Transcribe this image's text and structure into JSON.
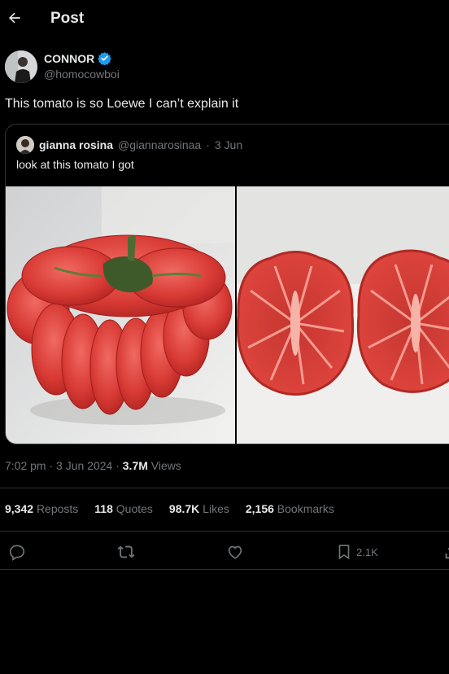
{
  "header": {
    "title": "Post"
  },
  "author": {
    "name": "CONNOR",
    "handle": "@homocowboi"
  },
  "post": {
    "text": "This tomato is so Loewe I can’t explain it"
  },
  "quoted": {
    "name": "gianna rosina",
    "handle": "@giannarosinaa",
    "separator": "·",
    "date": "3 Jun",
    "text": "look at this tomato I got"
  },
  "meta": {
    "time": "7:02 pm · 3 Jun 2024 ·",
    "views": "3.7M",
    "views_label": "Views"
  },
  "stats": {
    "reposts": "9,342",
    "reposts_label": "Reposts",
    "quotes": "118",
    "quotes_label": "Quotes",
    "likes": "98.7K",
    "likes_label": "Likes",
    "bookmarks": "2,156",
    "bookmarks_label": "Bookmarks"
  },
  "actions": {
    "bookmark_count": "2.1K"
  },
  "colors": {
    "background": "#000000",
    "text": "#e7e9ea",
    "muted": "#71767b",
    "border": "#2f3336",
    "verified": "#1d9bf0"
  }
}
